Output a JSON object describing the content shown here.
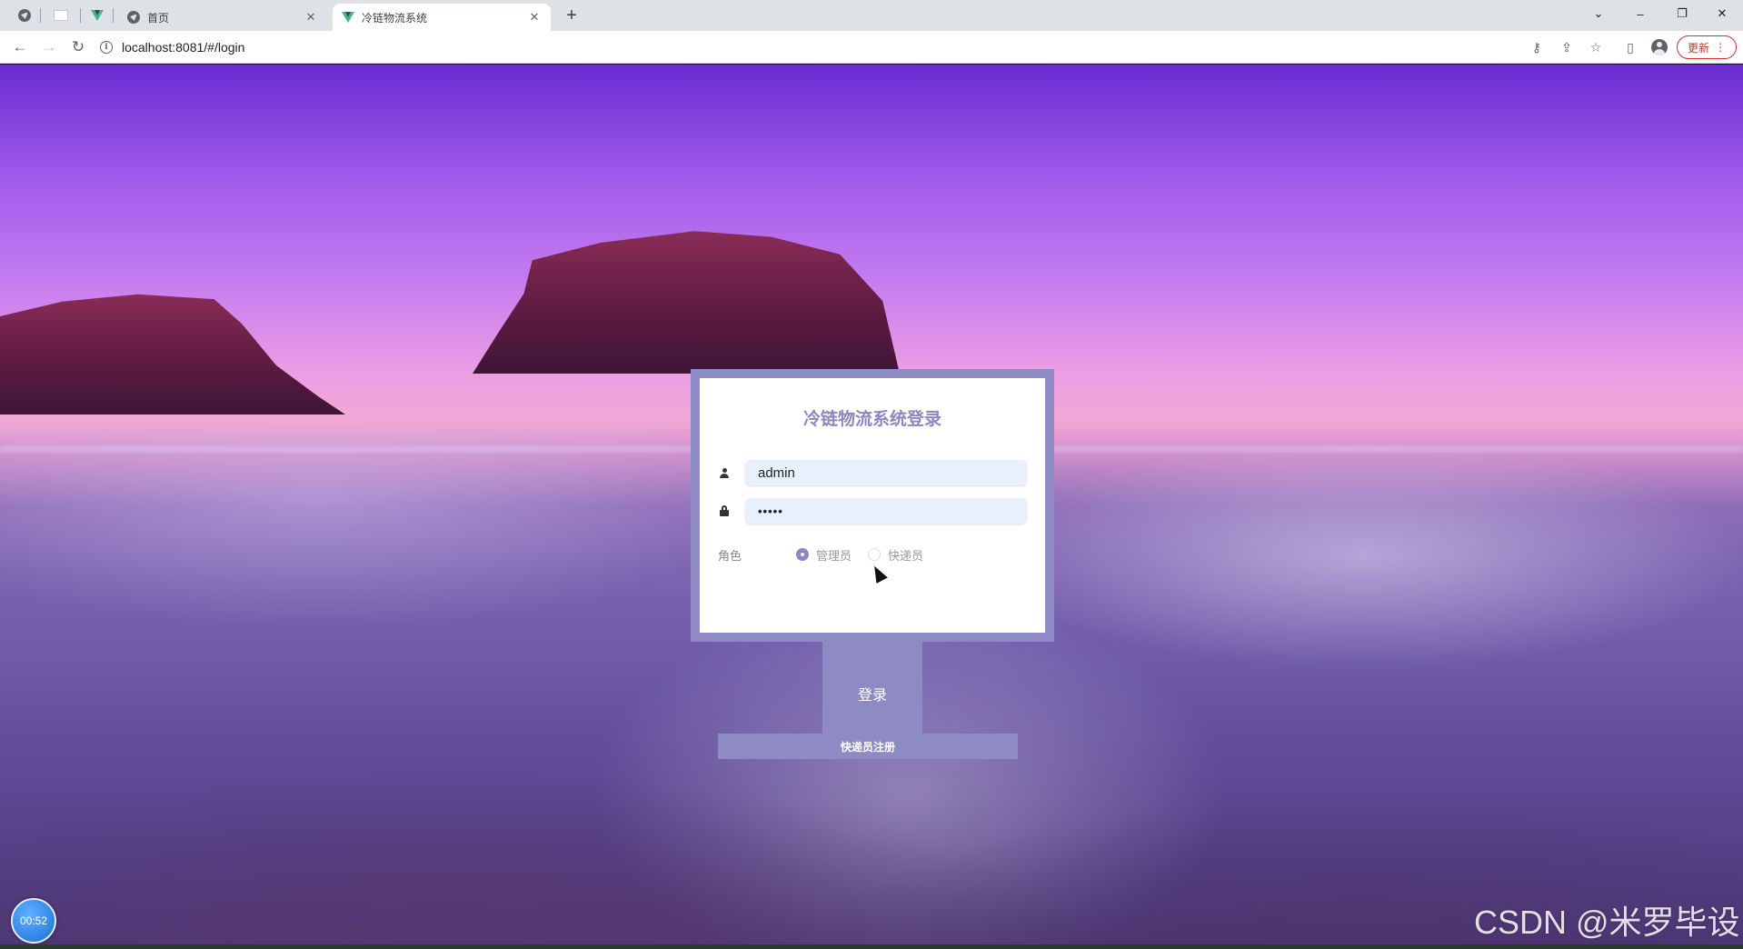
{
  "browser": {
    "tabs": [
      {
        "title": "首页",
        "close": "✕",
        "active": false
      },
      {
        "title": "冷链物流系统",
        "close": "✕",
        "active": true
      }
    ],
    "new_tab": "+",
    "url": "localhost:8081/#/login",
    "update_label": "更新",
    "update_menu": "⋮",
    "window_controls": {
      "dropdown": "⌄",
      "minimize": "–",
      "restore": "❐",
      "close": "✕"
    },
    "nav": {
      "back": "←",
      "forward": "→",
      "reload": "↻"
    },
    "icons": [
      "key-icon",
      "share-icon",
      "star-icon",
      "sidebar-icon",
      "profile-icon"
    ]
  },
  "login": {
    "title": "冷链物流系统登录",
    "username_value": "admin",
    "password_value": "•••••",
    "role_label": "角色",
    "roles": [
      {
        "label": "管理员",
        "checked": true
      },
      {
        "label": "快递员",
        "checked": false
      }
    ],
    "submit_label": "登录",
    "register_label": "快递员注册"
  },
  "overlay": {
    "timer": "00:52",
    "watermark": "CSDN @米罗毕设"
  },
  "colors": {
    "accent": "#8e8ac4",
    "title": "#8e86c2",
    "input_bg": "#e8f0fe"
  }
}
